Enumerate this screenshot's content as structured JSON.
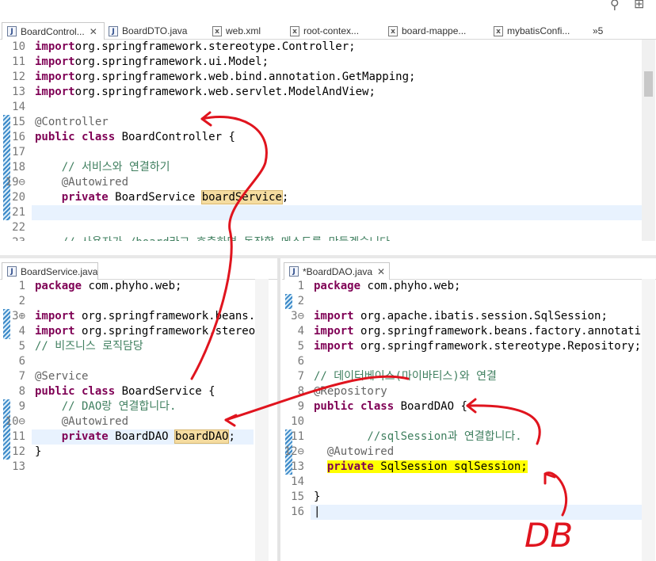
{
  "top_tabs": [
    {
      "label": "BoardControl...",
      "icon": "java-file-icon",
      "active": true,
      "close": "✕"
    },
    {
      "label": "BoardDTO.java",
      "icon": "java-file-icon"
    },
    {
      "label": "web.xml",
      "icon": "xml-file-icon"
    },
    {
      "label": "root-contex...",
      "icon": "xml-file-icon"
    },
    {
      "label": "board-mappe...",
      "icon": "xml-file-icon"
    },
    {
      "label": "mybatisConfi...",
      "icon": "xml-file-icon"
    },
    {
      "label": "»5",
      "icon": "overflow-icon"
    }
  ],
  "controller_editor": {
    "lines": [
      {
        "n": "10",
        "segs": [
          [
            "kw",
            "import"
          ],
          [
            "",
            "org.springframework.stereotype.Controller;"
          ]
        ]
      },
      {
        "n": "11",
        "segs": [
          [
            "kw",
            "import"
          ],
          [
            "",
            "org.springframework.ui.Model;"
          ]
        ]
      },
      {
        "n": "12",
        "segs": [
          [
            "kw",
            "import"
          ],
          [
            "",
            "org.springframework.web.bind.annotation.GetMapping;"
          ]
        ]
      },
      {
        "n": "13",
        "segs": [
          [
            "kw",
            "import"
          ],
          [
            "",
            "org.springframework.web.servlet.ModelAndView;"
          ]
        ]
      },
      {
        "n": "14",
        "segs": []
      },
      {
        "n": "15",
        "segs": [
          [
            "ann",
            "@Controller"
          ]
        ]
      },
      {
        "n": "16",
        "segs": [
          [
            "kw",
            "public class"
          ],
          [
            "",
            " BoardController {"
          ]
        ]
      },
      {
        "n": "17",
        "segs": []
      },
      {
        "n": "18",
        "segs": [
          [
            "cm",
            "    // 서비스와 연결하기"
          ]
        ]
      },
      {
        "n": "19⊖",
        "segs": [
          [
            "ann",
            "    @Autowired"
          ]
        ]
      },
      {
        "n": "20",
        "segs": [
          [
            "kw",
            "    private"
          ],
          [
            "",
            " BoardService "
          ],
          [
            "hl",
            "boardService"
          ],
          [
            "",
            ";"
          ]
        ]
      },
      {
        "n": "21",
        "segs": []
      },
      {
        "n": "22",
        "segs": []
      },
      {
        "n": "23",
        "segs": [
          [
            "cm",
            "    // 사용자가 /board라고 호출하면 동작할 메소드를 만들겠습니다"
          ]
        ]
      }
    ]
  },
  "service_tab": {
    "label": "BoardService.java",
    "icon": "java-file-icon"
  },
  "service_editor": {
    "lines": [
      {
        "n": "1",
        "segs": [
          [
            "kw",
            "package"
          ],
          [
            "",
            " com.phyho.web;"
          ]
        ]
      },
      {
        "n": "2",
        "segs": []
      },
      {
        "n": "3⊕",
        "segs": [
          [
            "kw",
            "import"
          ],
          [
            "",
            " org.springframework.beans.fa"
          ]
        ]
      },
      {
        "n": "4",
        "segs": [
          [
            "kw",
            "import"
          ],
          [
            "",
            " org.springframework.stereoty"
          ]
        ]
      },
      {
        "n": "5",
        "segs": [
          [
            "cm",
            "// 비즈니스 로직담당"
          ]
        ]
      },
      {
        "n": "6",
        "segs": []
      },
      {
        "n": "7",
        "segs": [
          [
            "ann",
            "@Service"
          ]
        ]
      },
      {
        "n": "8",
        "segs": [
          [
            "kw",
            "public class"
          ],
          [
            "",
            " BoardService {"
          ]
        ]
      },
      {
        "n": "9",
        "segs": [
          [
            "cm",
            "    // DAO랑 연결합니다."
          ]
        ]
      },
      {
        "n": "10⊖",
        "segs": [
          [
            "ann",
            "    @Autowired"
          ]
        ]
      },
      {
        "n": "11",
        "segs": [
          [
            "kw",
            "    private"
          ],
          [
            "",
            " BoardDAO "
          ],
          [
            "hl",
            "boardDAO"
          ],
          [
            "",
            ";"
          ]
        ]
      },
      {
        "n": "12",
        "segs": [
          [
            "",
            "}"
          ]
        ]
      },
      {
        "n": "13",
        "segs": []
      }
    ]
  },
  "dao_tab": {
    "label": "*BoardDAO.java",
    "icon": "java-file-icon",
    "close": "✕"
  },
  "dao_editor": {
    "lines": [
      {
        "n": "1",
        "segs": [
          [
            "kw",
            "package"
          ],
          [
            "",
            " com.phyho.web;"
          ]
        ]
      },
      {
        "n": "2",
        "segs": []
      },
      {
        "n": "3⊖",
        "segs": [
          [
            "kw",
            "import"
          ],
          [
            "",
            " org.apache.ibatis.session.SqlSession;"
          ]
        ]
      },
      {
        "n": "4",
        "segs": [
          [
            "kw",
            "import"
          ],
          [
            "",
            " org.springframework.beans.factory.annotation."
          ]
        ]
      },
      {
        "n": "5",
        "segs": [
          [
            "kw",
            "import"
          ],
          [
            "",
            " org.springframework.stereotype.Repository;"
          ]
        ]
      },
      {
        "n": "6",
        "segs": []
      },
      {
        "n": "7",
        "segs": [
          [
            "cm",
            "// 데이터베이스(마이바티스)와 연결"
          ]
        ]
      },
      {
        "n": "8",
        "segs": [
          [
            "ann",
            "@Repository"
          ]
        ]
      },
      {
        "n": "9",
        "segs": [
          [
            "kw",
            "public class"
          ],
          [
            "",
            " BoardDAO {"
          ]
        ]
      },
      {
        "n": "10",
        "segs": []
      },
      {
        "n": "11",
        "segs": [
          [
            "cm",
            "        //sqlSession과 연결합니다."
          ]
        ]
      },
      {
        "n": "12⊖",
        "segs": [
          [
            "ann",
            "  @Autowired"
          ]
        ]
      },
      {
        "n": "13",
        "segs": [
          [
            "",
            "  "
          ],
          [
            "ykw",
            "private"
          ],
          [
            "y",
            " SqlSession sqlSession;"
          ]
        ]
      },
      {
        "n": "14",
        "segs": []
      },
      {
        "n": "15",
        "segs": [
          [
            "",
            "}"
          ]
        ]
      },
      {
        "n": "16",
        "segs": [
          [
            "",
            "|"
          ]
        ]
      }
    ]
  },
  "annotation": {
    "handwritten_text": "DB",
    "color": "#e0141e"
  },
  "colors": {
    "keyword": "#7f0055",
    "comment": "#3f7f5f",
    "annotation": "#646464",
    "current_line": "#e8f2fe",
    "highlight_yellow": "#ffff00"
  }
}
